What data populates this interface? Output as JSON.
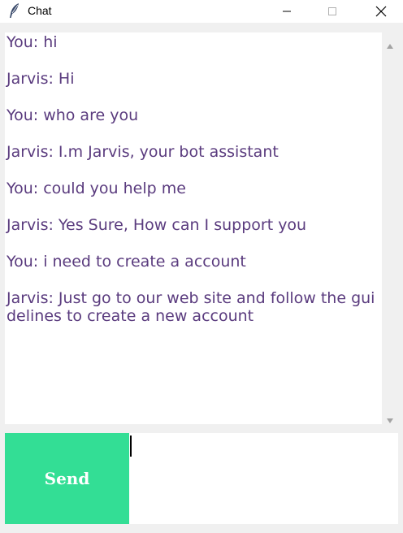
{
  "window": {
    "title": "Chat",
    "app_icon": "feather-icon"
  },
  "chat": {
    "messages": [
      "You: hi",
      "Jarvis: Hi",
      "You: who are you",
      "Jarvis: I.m Jarvis, your bot assistant",
      "You: could you help me",
      "Jarvis: Yes Sure, How can I support you",
      "You: i need to create a account",
      "Jarvis: Just go to our web site and follow the guidelines to create a new account"
    ],
    "text_color": "#5a3b7e"
  },
  "composer": {
    "send_label": "Send",
    "send_color": "#33de95",
    "input_value": ""
  }
}
